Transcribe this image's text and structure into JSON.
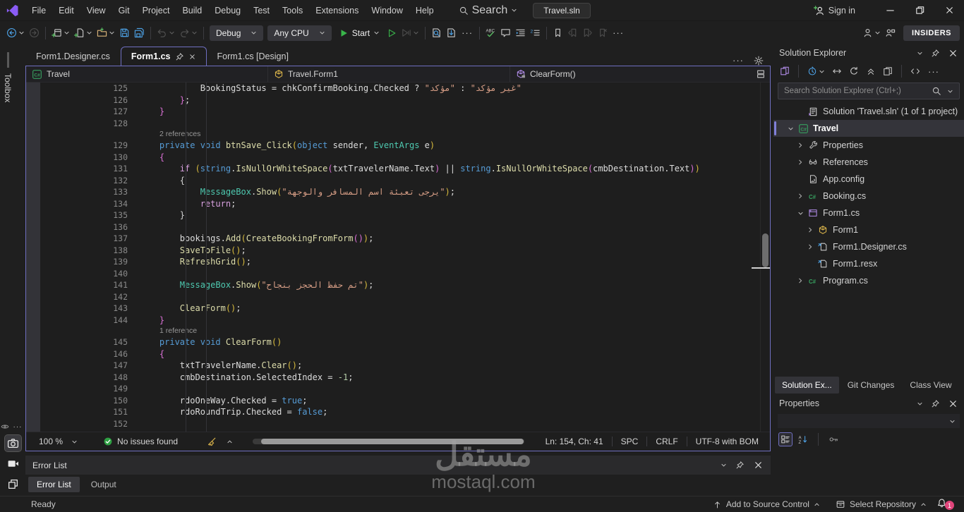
{
  "title_bar": {
    "menus": [
      "File",
      "Edit",
      "View",
      "Git",
      "Project",
      "Build",
      "Debug",
      "Test",
      "Tools",
      "Extensions",
      "Window",
      "Help"
    ],
    "search_label": "Search",
    "solution_chip": "Travel.sln",
    "sign_in": "Sign in",
    "window_icons": [
      "minimize",
      "restore",
      "close"
    ]
  },
  "toolbar": {
    "left_icons": [
      "nav-back^",
      "nav-forward!",
      "|",
      "new-project^",
      "add-item^",
      "open-folder^",
      "save",
      "save-all",
      "|",
      "undo!^",
      "redo!^",
      "|"
    ],
    "debug_config": "Debug",
    "platform": "Any CPU",
    "start_label": "Start",
    "right_icons": [
      "run-outline",
      "profiler!^",
      "|",
      "find-in-files",
      "find-next",
      "...",
      "|",
      "spell-check",
      "comment",
      "format-indent",
      "format-indent2",
      "|",
      "bookmark",
      "bookmark-prev!",
      "bookmark-next!",
      "bookmark-clear!",
      "..."
    ],
    "live_share_icon": "live-share",
    "feedback_icon": "feedback",
    "insiders_label": "INSIDERS"
  },
  "dock_left": {
    "toolbox_label": "Toolbox",
    "bottom_icons": [
      "eye",
      "camera*",
      "video",
      "layers",
      "gear"
    ]
  },
  "editor": {
    "tabs": [
      {
        "label": "Form1.Designer.cs",
        "active": false,
        "pinned": false
      },
      {
        "label": "Form1.cs",
        "active": true,
        "pinned": true
      },
      {
        "label": "Form1.cs [Design]",
        "active": false,
        "pinned": false
      }
    ],
    "navbar": {
      "project": "Travel",
      "type": "Travel.Form1",
      "member": "ClearForm()"
    },
    "code": [
      {
        "n": "125",
        "t": [
          [
            "d",
            "            BookingStatus = chkConfirmBooking.Checked ? "
          ],
          [
            "s",
            "\"مؤكد\""
          ],
          [
            "d",
            " : "
          ],
          [
            "s",
            "\"غير مؤكد\""
          ]
        ]
      },
      {
        "n": "126",
        "t": [
          [
            "d",
            "        "
          ],
          [
            "bv",
            "}"
          ],
          [
            "d",
            ";"
          ]
        ]
      },
      {
        "n": "127",
        "t": [
          [
            "d",
            "    "
          ],
          [
            "bv",
            "}"
          ]
        ]
      },
      {
        "n": "128",
        "t": []
      },
      {
        "lens": "2 references"
      },
      {
        "n": "129",
        "t": [
          [
            "d",
            "    "
          ],
          [
            "k",
            "private"
          ],
          [
            "d",
            " "
          ],
          [
            "k",
            "void"
          ],
          [
            "d",
            " "
          ],
          [
            "m",
            "btnSave_Click"
          ],
          [
            "p1",
            "("
          ],
          [
            "k",
            "object"
          ],
          [
            "d",
            " sender, "
          ],
          [
            "t",
            "EventArgs"
          ],
          [
            "d",
            " e"
          ],
          [
            "p1",
            ")"
          ]
        ]
      },
      {
        "n": "130",
        "t": [
          [
            "d",
            "    "
          ],
          [
            "bv",
            "{"
          ]
        ]
      },
      {
        "n": "131",
        "t": [
          [
            "d",
            "        "
          ],
          [
            "c",
            "if"
          ],
          [
            "d",
            " "
          ],
          [
            "p1",
            "("
          ],
          [
            "k",
            "string"
          ],
          [
            "d",
            "."
          ],
          [
            "m",
            "IsNullOrWhiteSpace"
          ],
          [
            "p2",
            "("
          ],
          [
            "d",
            "txtTravelerName.Text"
          ],
          [
            "p2",
            ")"
          ],
          [
            "d",
            " || "
          ],
          [
            "k",
            "string"
          ],
          [
            "d",
            "."
          ],
          [
            "m",
            "IsNullOrWhiteSpace"
          ],
          [
            "p2",
            "("
          ],
          [
            "d",
            "cmbDestination.Text"
          ],
          [
            "p2",
            ")"
          ],
          [
            "p1",
            ")"
          ]
        ]
      },
      {
        "n": "132",
        "t": [
          [
            "d",
            "        "
          ],
          [
            "bb",
            "{"
          ]
        ]
      },
      {
        "n": "133",
        "t": [
          [
            "d",
            "            "
          ],
          [
            "t",
            "MessageBox"
          ],
          [
            "d",
            "."
          ],
          [
            "m",
            "Show"
          ],
          [
            "p1",
            "("
          ],
          [
            "s",
            "\"يرجى تعبئة اسم المسافر والوجهة\""
          ],
          [
            "p1",
            ")"
          ],
          [
            "d",
            ";"
          ]
        ]
      },
      {
        "n": "134",
        "t": [
          [
            "d",
            "            "
          ],
          [
            "c",
            "return"
          ],
          [
            "d",
            ";"
          ]
        ]
      },
      {
        "n": "135",
        "t": [
          [
            "d",
            "        "
          ],
          [
            "bb",
            "}"
          ]
        ]
      },
      {
        "n": "136",
        "t": []
      },
      {
        "n": "137",
        "t": [
          [
            "d",
            "        bookings."
          ],
          [
            "m",
            "Add"
          ],
          [
            "p1",
            "("
          ],
          [
            "m",
            "CreateBookingFromForm"
          ],
          [
            "p2",
            "()"
          ],
          [
            "p1",
            ")"
          ],
          [
            "d",
            ";"
          ]
        ]
      },
      {
        "n": "138",
        "t": [
          [
            "d",
            "        "
          ],
          [
            "m",
            "SaveToFile"
          ],
          [
            "p1",
            "()"
          ],
          [
            "d",
            ";"
          ]
        ]
      },
      {
        "n": "139",
        "t": [
          [
            "d",
            "        "
          ],
          [
            "m",
            "RefreshGrid"
          ],
          [
            "p1",
            "()"
          ],
          [
            "d",
            ";"
          ]
        ]
      },
      {
        "n": "140",
        "t": []
      },
      {
        "n": "141",
        "t": [
          [
            "d",
            "        "
          ],
          [
            "t",
            "MessageBox"
          ],
          [
            "d",
            "."
          ],
          [
            "m",
            "Show"
          ],
          [
            "p1",
            "("
          ],
          [
            "s",
            "\"تم حفظ الحجز بنجاح\""
          ],
          [
            "p1",
            ")"
          ],
          [
            "d",
            ";"
          ]
        ]
      },
      {
        "n": "142",
        "t": []
      },
      {
        "n": "143",
        "t": [
          [
            "d",
            "        "
          ],
          [
            "m",
            "ClearForm"
          ],
          [
            "p1",
            "()"
          ],
          [
            "d",
            ";"
          ]
        ]
      },
      {
        "n": "144",
        "t": [
          [
            "d",
            "    "
          ],
          [
            "bv",
            "}"
          ]
        ]
      },
      {
        "lens": "1 reference"
      },
      {
        "n": "145",
        "t": [
          [
            "d",
            "    "
          ],
          [
            "k",
            "private"
          ],
          [
            "d",
            " "
          ],
          [
            "k",
            "void"
          ],
          [
            "d",
            " "
          ],
          [
            "m",
            "ClearForm"
          ],
          [
            "p1",
            "()"
          ]
        ]
      },
      {
        "n": "146",
        "t": [
          [
            "d",
            "    "
          ],
          [
            "bv",
            "{"
          ]
        ]
      },
      {
        "n": "147",
        "t": [
          [
            "d",
            "        txtTravelerName."
          ],
          [
            "m",
            "Clear"
          ],
          [
            "p1",
            "()"
          ],
          [
            "d",
            ";"
          ]
        ]
      },
      {
        "n": "148",
        "t": [
          [
            "d",
            "        cmbDestination.SelectedIndex = "
          ],
          [
            "n2",
            "-1"
          ],
          [
            "d",
            ";"
          ]
        ]
      },
      {
        "n": "149",
        "t": []
      },
      {
        "n": "150",
        "t": [
          [
            "d",
            "        rdoOneWay.Checked = "
          ],
          [
            "k",
            "true"
          ],
          [
            "d",
            ";"
          ]
        ]
      },
      {
        "n": "151",
        "t": [
          [
            "d",
            "        rdoRoundTrip.Checked = "
          ],
          [
            "k",
            "false"
          ],
          [
            "d",
            ";"
          ]
        ]
      },
      {
        "n": "152",
        "t": []
      }
    ],
    "statusbar": {
      "zoom": "100 %",
      "issues": "No issues found",
      "position": "Ln: 154, Ch: 41",
      "spaces": "SPC",
      "line_ending": "CRLF",
      "encoding": "UTF-8 with BOM"
    }
  },
  "solution_explorer": {
    "title": "Solution Explorer",
    "toolbar_icons": [
      "home-switch",
      "|",
      "history^",
      "sync",
      "refresh",
      "collapse-all",
      "preview",
      "|",
      "code-tags",
      "..."
    ],
    "search_placeholder": "Search Solution Explorer (Ctrl+;)",
    "tree": [
      {
        "lvl": 1,
        "chev": "",
        "icon": "solution",
        "label": "Solution 'Travel.sln' (1 of 1 project)"
      },
      {
        "lvl": 0,
        "chev": "v",
        "icon": "csproj",
        "label": "Travel",
        "bold": true,
        "selected": true
      },
      {
        "lvl": 1,
        "chev": ">",
        "icon": "wrench",
        "label": "Properties"
      },
      {
        "lvl": 1,
        "chev": ">",
        "icon": "references",
        "label": "References"
      },
      {
        "lvl": 1,
        "chev": "",
        "icon": "config",
        "label": "App.config"
      },
      {
        "lvl": 1,
        "chev": ">",
        "icon": "csfile",
        "label": "Booking.cs"
      },
      {
        "lvl": 1,
        "chev": "v",
        "icon": "winform",
        "label": "Form1.cs"
      },
      {
        "lvl": 2,
        "chev": ">",
        "icon": "formclass",
        "label": "Form1"
      },
      {
        "lvl": 2,
        "chev": ">",
        "icon": "filedep",
        "label": "Form1.Designer.cs"
      },
      {
        "lvl": 2,
        "chev": "",
        "icon": "filedep",
        "label": "Form1.resx"
      },
      {
        "lvl": 1,
        "chev": ">",
        "icon": "csfile",
        "label": "Program.cs"
      }
    ]
  },
  "panel_tabs": [
    {
      "label": "Solution Ex...",
      "active": true
    },
    {
      "label": "Git Changes",
      "active": false
    },
    {
      "label": "Class View",
      "active": false
    }
  ],
  "properties": {
    "title": "Properties",
    "toolbar_icons": [
      "categorized*",
      "az-sort",
      "|",
      "key"
    ]
  },
  "error_list": {
    "title": "Error List",
    "tabs": [
      {
        "label": "Error List",
        "active": true
      },
      {
        "label": "Output",
        "active": false
      }
    ]
  },
  "status_bar": {
    "ready": "Ready",
    "add_to_source_control": "Add to Source Control",
    "select_repository": "Select Repository",
    "notification_count": "1"
  },
  "watermark": {
    "line1": "مستقل",
    "line2": "mostaql.com"
  },
  "colors": {
    "accent_purple": "#6f6fc0",
    "start_green": "#39b54a",
    "badge_pink": "#e0457b",
    "editor_bg": "#1e1e1e",
    "chrome_bg": "#1f1f1f"
  }
}
